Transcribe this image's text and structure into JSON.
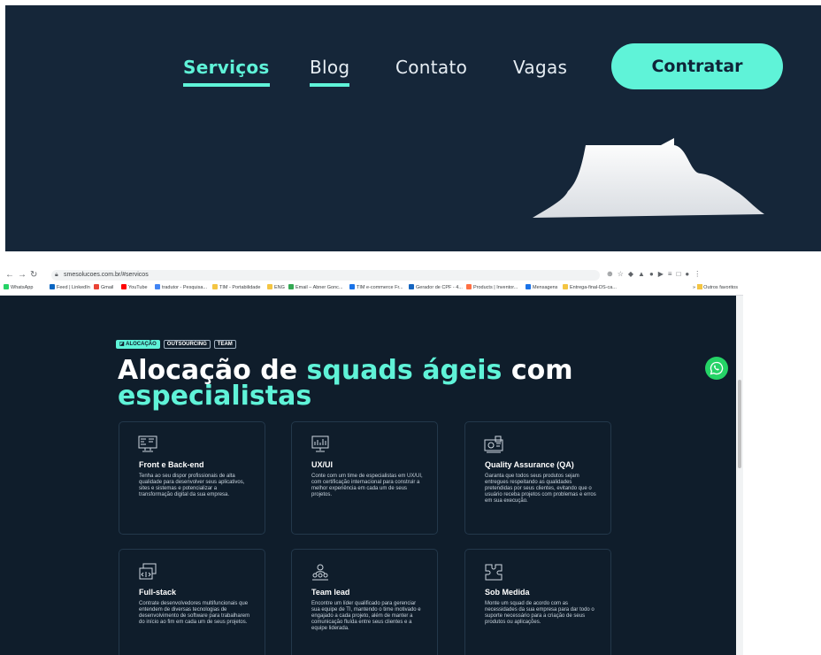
{
  "site_nav": {
    "links": [
      {
        "label": "Serviços",
        "active": true
      },
      {
        "label": "Blog",
        "active": false
      },
      {
        "label": "Contato",
        "active": false
      },
      {
        "label": "Vagas",
        "active": false
      }
    ],
    "cta_label": "Contratar"
  },
  "browser": {
    "url": "smesolucoes.com.br/#servicos",
    "bookmarks": [
      "WhatsApp",
      "Feed | LinkedIn",
      "Gmail",
      "YouTube",
      "tradutor - Pesquisa...",
      "TIM - Portabilidade",
      "ENG",
      "Email – Abner Gonc...",
      "TIM e-commerce Fr...",
      "Gerador de CPF - 4...",
      "Products | Inventor...",
      "Mensagens",
      "Entrega-final-DS-ca..."
    ],
    "other_bookmarks": "Outros favoritos"
  },
  "services": {
    "tags": [
      {
        "label": "ALOCAÇÃO",
        "active": true
      },
      {
        "label": "OUTSOURCING",
        "active": false
      },
      {
        "label": "TEAM",
        "active": false
      }
    ],
    "headline_part1": "Alocação de ",
    "headline_highlight1": "squads ágeis",
    "headline_part2": " com",
    "headline_highlight2": "especialistas",
    "cards": [
      {
        "title": "Front e Back-end",
        "desc": "Tenha ao seu dispor profissionais de alta qualidade para desenvolver seus aplicativos, sites e sistemas e potencializar a transformação digital da sua empresa.",
        "icon": "code-monitor-icon"
      },
      {
        "title": "UX/UI",
        "desc": "Conte com um time de especialistas em UX/UI, com certificação internacional para construir a melhor experiência em cada um de seus projetos.",
        "icon": "design-chart-icon"
      },
      {
        "title": "Quality Assurance (QA)",
        "desc": "Garanta que todos seus produtos sejam entregues respeitando as qualidades pretendidas por seus clientes, evitando que o usuário receba projetos com problemas e erros em sua execução.",
        "icon": "quality-check-icon"
      },
      {
        "title": "Full-stack",
        "desc": "Contrate desenvolvedores multifuncionais que entendem de diversas tecnologias de desenvolvimento de software para trabalharem do início ao fim em cada um de seus projetos.",
        "icon": "stack-windows-icon"
      },
      {
        "title": "Team lead",
        "desc": "Encontre um líder qualificado para gerenciar sua equipe de TI, mantendo o time motivado e engajado a cada projeto, além de manter a comunicação fluída entre seus clientes e a equipe liderada.",
        "icon": "team-leader-icon"
      },
      {
        "title": "Sob Medida",
        "desc": "Monte um squad de acordo com as necessidades da sua empresa para dar todo o suporte necessário para a criação de seus produtos ou aplicações.",
        "icon": "puzzle-icon"
      }
    ]
  },
  "colors": {
    "accent": "#5ff3d8",
    "nav_bg": "#152639",
    "page_bg": "#0f1d2b"
  }
}
